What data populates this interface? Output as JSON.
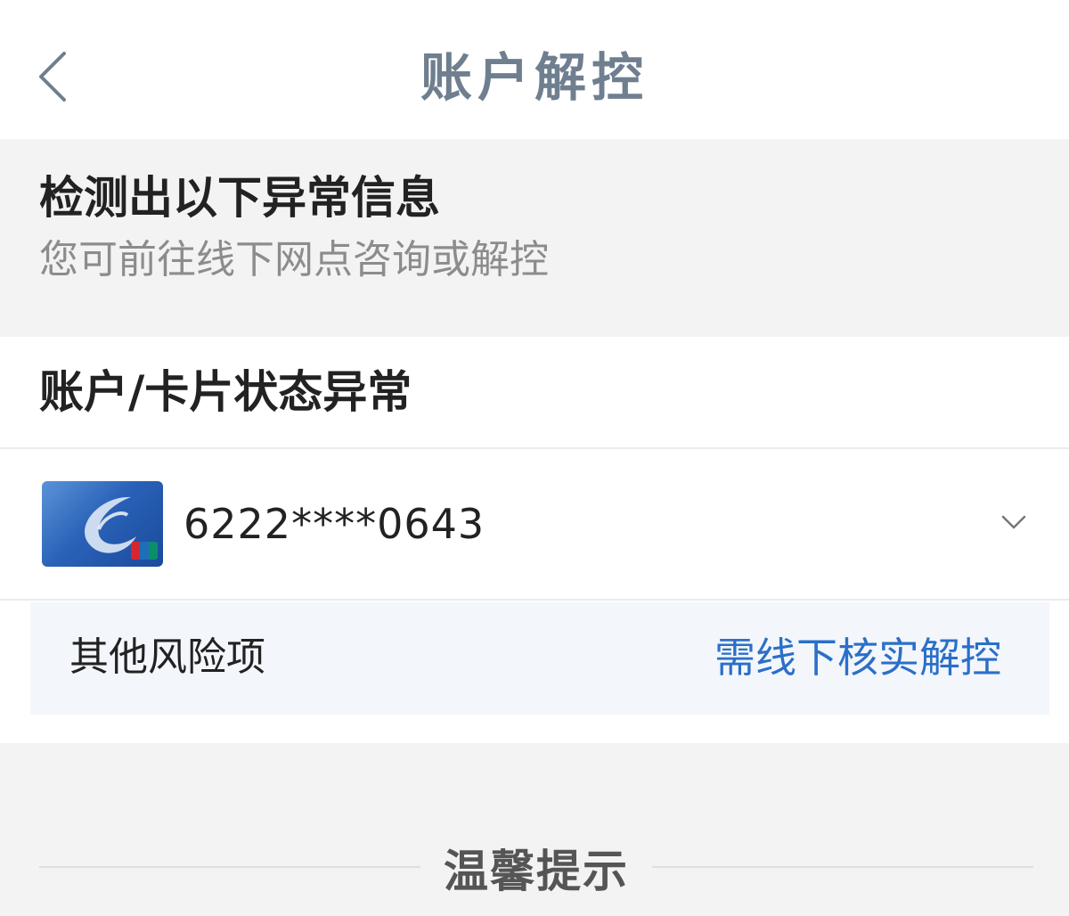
{
  "navbar": {
    "title": "账户解控",
    "back_icon": "chevron-left-icon"
  },
  "info": {
    "title": "检测出以下异常信息",
    "subtitle": "您可前往线下网点咨询或解控"
  },
  "card_section": {
    "title": "账户/卡片状态异常",
    "card": {
      "number": "6222****0643",
      "expand_icon": "chevron-down-icon"
    },
    "risk": {
      "label": "其他风险项",
      "action": "需线下核实解控"
    }
  },
  "tips": {
    "title": "温馨提示"
  },
  "colors": {
    "nav_title": "#6f7f8f",
    "link_blue": "#2b6fc8",
    "background": "#f3f3f4",
    "risk_bg": "#f3f6fb"
  }
}
